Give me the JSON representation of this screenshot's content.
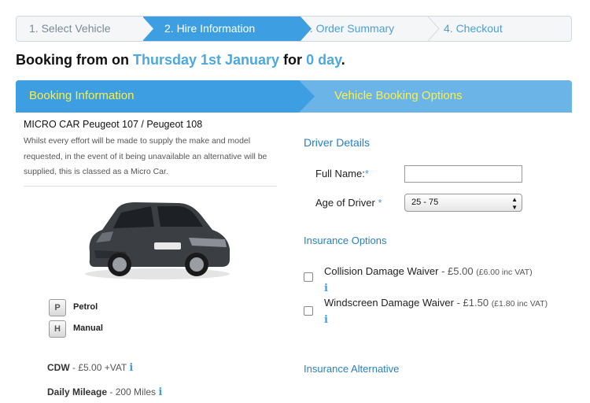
{
  "steps": [
    {
      "label": "1. Select Vehicle"
    },
    {
      "label": "2. Hire Information"
    },
    {
      "label": "3. Order Summary"
    },
    {
      "label": "4. Checkout"
    }
  ],
  "booking": {
    "prefix": "Booking from on ",
    "date": "Thursday 1st January",
    "for": " for ",
    "days": "0 day",
    "suffix": "."
  },
  "sections": {
    "left": "Booking Information",
    "right": "Vehicle Booking Options"
  },
  "vehicle": {
    "title": "MICRO CAR Peugeot 107 / Peugeot 108",
    "description": "Whilst every effort will be made to supply the make and model requested, in the event of it being unavailable an alternative will be supplied, this is classed as a Micro Car.",
    "features": [
      {
        "icon": "fuel-pump-icon",
        "label": "Petrol"
      },
      {
        "icon": "gearbox-icon",
        "label": "Manual"
      }
    ],
    "cdw_label": "CDW",
    "cdw_value": " - £5.00 +VAT",
    "mileage_label": "Daily Mileage",
    "mileage_value": " - 200 Miles"
  },
  "driver": {
    "heading": "Driver Details",
    "full_name_label": "Full Name:",
    "full_name_value": "",
    "age_label": "Age of Driver ",
    "age_value": "25 - 75",
    "required_mark": "*"
  },
  "insurance": {
    "heading": "Insurance Options",
    "options": [
      {
        "name": "Collision Damage Waiver",
        "price": " - £5.00",
        "inc": "(£6.00 inc VAT)",
        "checked": false
      },
      {
        "name": "Windscreen Damage Waiver",
        "price": " - £1.50",
        "inc": "(£1.80 inc VAT)",
        "checked": false
      }
    ],
    "alternative_heading": "Insurance Alternative"
  },
  "info_glyph": "i",
  "colors": {
    "step_active": "#3d9ee1",
    "highlight": "#4ea8e0",
    "section_label": "#ffee44",
    "heading_blue": "#2a7fc0",
    "car_body": "#3b3f44"
  }
}
